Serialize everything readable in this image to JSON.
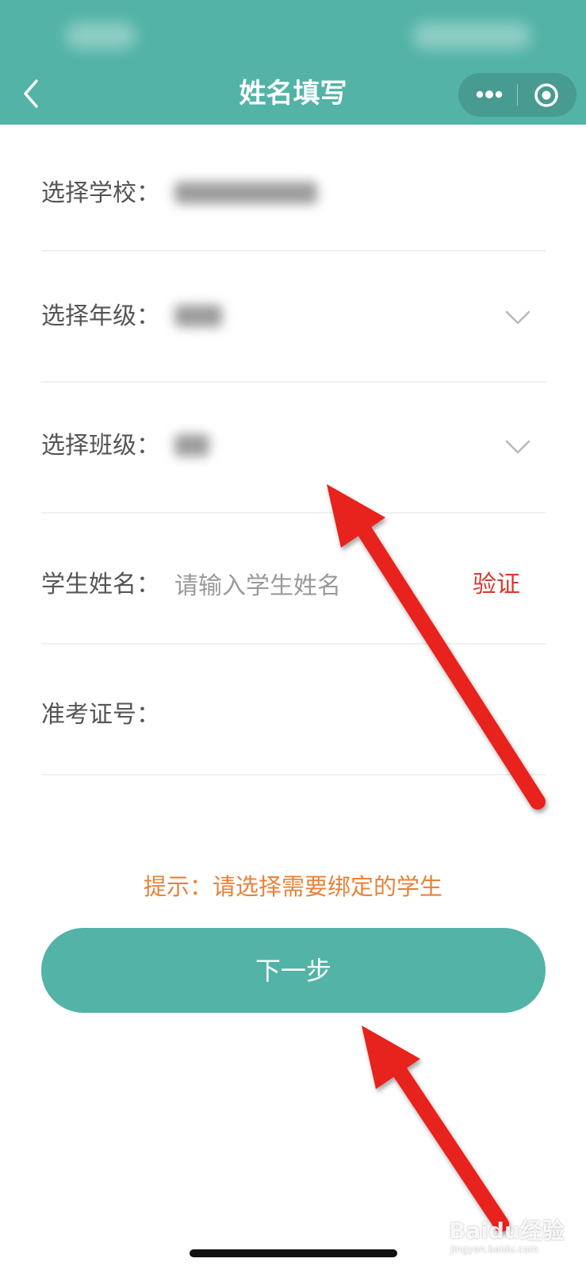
{
  "nav": {
    "title": "姓名填写",
    "background": "#52b3a6",
    "back_icon": "chevron-left-icon",
    "more_icon": "more-dots-icon",
    "close_icon": "target-circle-icon"
  },
  "form": {
    "school": {
      "label": "选择学校："
    },
    "grade": {
      "label": "选择年级："
    },
    "class": {
      "label": "选择班级："
    },
    "student_name": {
      "label": "学生姓名：",
      "placeholder": "请输入学生姓名",
      "verify_label": "验证"
    },
    "ticket": {
      "label": "准考证号：",
      "value": ""
    }
  },
  "hint": "提示：请选择需要绑定的学生",
  "next_button": {
    "label": "下一步",
    "color": "#52b3a6"
  },
  "watermark": {
    "text": "Baidu经验",
    "sub": "jingyan.baidu.com"
  },
  "colors": {
    "accent": "#52b3a6",
    "verify": "#d53a2e",
    "hint": "#e8823a",
    "annotation_arrow": "#e8231f"
  }
}
